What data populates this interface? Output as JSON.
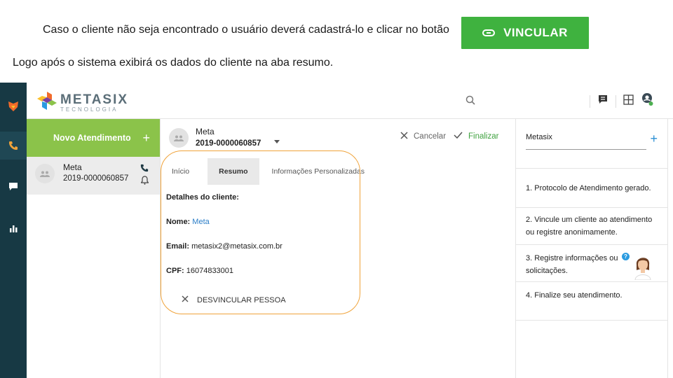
{
  "instructions": {
    "line1": "Caso o cliente não seja encontrado o usuário deverá cadastrá-lo e clicar no botão",
    "line2": "Logo após o sistema exibirá os dados do cliente na aba resumo."
  },
  "vincular_button": {
    "label": "VINCULAR",
    "icon": "link-icon",
    "color": "#3fb23f"
  },
  "app": {
    "brand": {
      "name": "METASIX",
      "tagline": "TECNOLOGIA"
    },
    "topbar_icons": [
      "search-icon",
      "chat-icon",
      "grid-icon",
      "user-status-icon"
    ],
    "rail_icons": [
      "fox-logo-icon",
      "phone-icon",
      "chat-icon",
      "bar-chart-icon"
    ],
    "left_panel": {
      "new_button": "Novo Atendimento",
      "new_button_color": "#8bc34a",
      "sessions": [
        {
          "name": "Meta",
          "protocol": "2019-0000060857"
        }
      ]
    },
    "center": {
      "contact_name": "Meta",
      "protocol": "2019-0000060857",
      "cancel_label": "Cancelar",
      "finish_label": "Finalizar",
      "tabs": [
        {
          "label": "Início",
          "active": false
        },
        {
          "label": "Resumo",
          "active": true
        },
        {
          "label": "Informações Personalizadas",
          "active": false
        }
      ],
      "details": {
        "title": "Detalhes do cliente:",
        "name_label": "Nome:",
        "name_value": "Meta",
        "email_label": "Email:",
        "email_value": "metasix2@metasix.com.br",
        "cpf_label": "CPF:",
        "cpf_value": "16074833001"
      },
      "unlink_label": "DESVINCULAR PESSOA"
    },
    "right_panel": {
      "title": "Metasix",
      "steps": [
        "1. Protocolo de Atendimento gerado.",
        "2. Vincule um cliente ao atendimento ou registre anonimamente.",
        "3. Registre informações ou solicitações.",
        "4. Finalize seu atendimento."
      ]
    }
  }
}
